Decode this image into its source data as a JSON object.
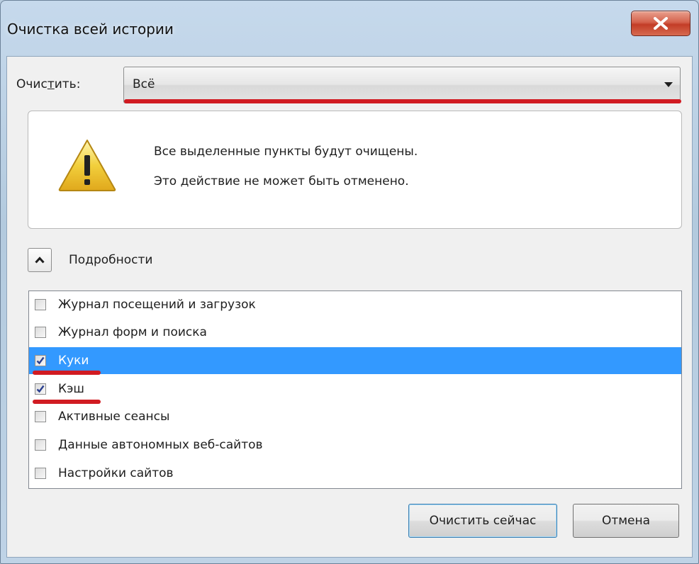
{
  "window": {
    "title": "Очистка всей истории",
    "close_symbol": "x"
  },
  "clear": {
    "label_before": "Очис",
    "label_underlined": "т",
    "label_after": "ить:",
    "selected": "Всё"
  },
  "warning": {
    "line1": "Все выделенные пункты будут очищены.",
    "line2": "Это действие не может быть отменено."
  },
  "details": {
    "label": "Подробности",
    "expanded": true
  },
  "items": [
    {
      "label": "Журнал посещений и загрузок",
      "checked": false,
      "selected": false
    },
    {
      "label": "Журнал форм и поиска",
      "checked": false,
      "selected": false
    },
    {
      "label": "Куки",
      "checked": true,
      "selected": true
    },
    {
      "label": "Кэш",
      "checked": true,
      "selected": false
    },
    {
      "label": "Активные сеансы",
      "checked": false,
      "selected": false
    },
    {
      "label": "Данные автономных веб-сайтов",
      "checked": false,
      "selected": false
    },
    {
      "label": "Настройки сайтов",
      "checked": false,
      "selected": false
    }
  ],
  "buttons": {
    "clear_now": "Очистить сейчас",
    "cancel": "Отмена"
  },
  "colors": {
    "highlight": "#3399ff",
    "annotation_red": "#d11b22",
    "close_red": "#c33d27"
  }
}
